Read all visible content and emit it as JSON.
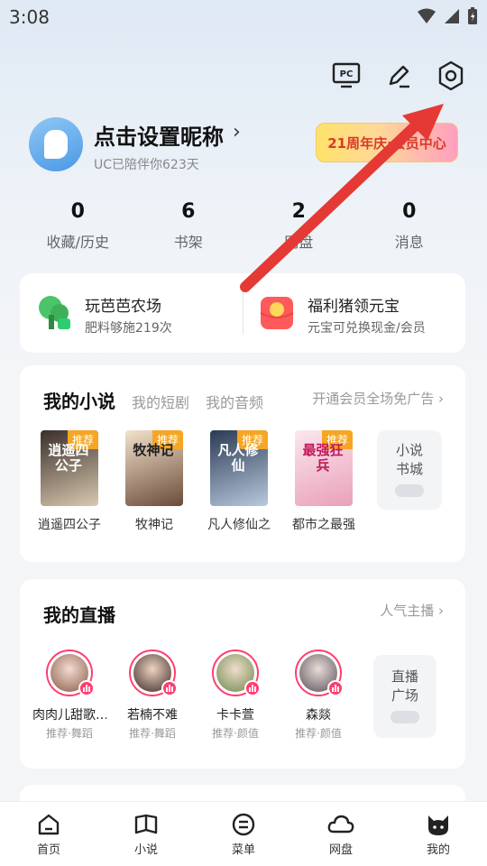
{
  "status": {
    "time": "3:08"
  },
  "top_icons": [
    "pc-icon",
    "edit-icon",
    "settings-icon"
  ],
  "profile": {
    "nickname": "点击设置昵称",
    "subtitle": "UC已陪伴你623天",
    "badge": "21周年庆·会员中心"
  },
  "stats": [
    {
      "num": "0",
      "label": "收藏/历史"
    },
    {
      "num": "6",
      "label": "书架"
    },
    {
      "num": "2",
      "label": "网盘"
    },
    {
      "num": "0",
      "label": "消息"
    }
  ],
  "promo": {
    "left": {
      "title": "玩芭芭农场",
      "sub": "肥料够施219次"
    },
    "right": {
      "title": "福利猪领元宝",
      "sub": "元宝可兑换现金/会员"
    }
  },
  "novels": {
    "tab_active": "我的小说",
    "tab2": "我的短剧",
    "tab3": "我的音频",
    "vip": "开通会员全场免广告",
    "tag": "推荐",
    "books": [
      {
        "name": "逍遥四公子",
        "cover_text": "逍遥四公子",
        "c1": "#3a2f2a",
        "c2": "#d9c9b0",
        "tc": "#fff"
      },
      {
        "name": "牧神记",
        "cover_text": "牧神记",
        "c1": "#f2e2cc",
        "c2": "#6b4b3a",
        "tc": "#222"
      },
      {
        "name": "凡人修仙之",
        "cover_text": "凡人修仙",
        "c1": "#2b3b55",
        "c2": "#b8c8dd",
        "tc": "#fff"
      },
      {
        "name": "都市之最强",
        "cover_text": "最强狂兵",
        "c1": "#fbe7ef",
        "c2": "#e9a0b8",
        "tc": "#c2185b"
      }
    ],
    "more_line1": "小说",
    "more_line2": "书城"
  },
  "live": {
    "title": "我的直播",
    "link": "人气主播",
    "streamers": [
      {
        "name": "肉肉儿甜歌…",
        "tag": "推荐·舞蹈",
        "c": "#e8c7b8"
      },
      {
        "name": "若楠不难",
        "tag": "推荐·舞蹈",
        "c": "#d9b6a0"
      },
      {
        "name": "卡卡萱",
        "tag": "推荐·颜值",
        "c": "#b9d3a8"
      },
      {
        "name": "森燚",
        "tag": "推荐·颜值",
        "c": "#c9c3c8"
      }
    ],
    "more_line1": "直播",
    "more_line2": "广场"
  },
  "nav": [
    {
      "label": "首页",
      "icon": "home-icon"
    },
    {
      "label": "小说",
      "icon": "book-icon"
    },
    {
      "label": "菜单",
      "icon": "menu-icon"
    },
    {
      "label": "网盘",
      "icon": "cloud-icon"
    },
    {
      "label": "我的",
      "icon": "profile-icon"
    }
  ],
  "colors": {
    "accent_red": "#ff3d6e",
    "arrow": "#e53935"
  }
}
